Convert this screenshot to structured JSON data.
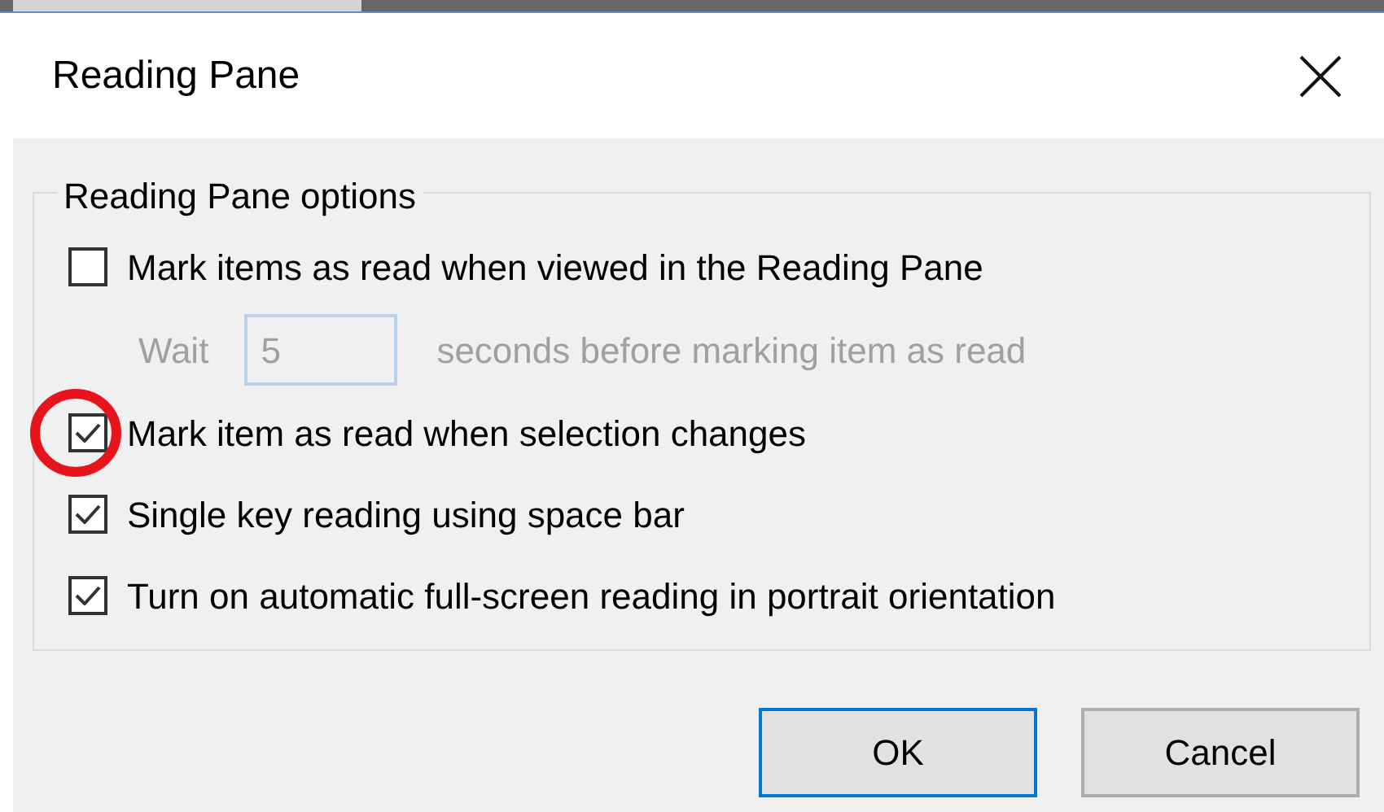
{
  "window": {
    "title": "Reading Pane"
  },
  "group": {
    "legend": "Reading Pane options"
  },
  "options": [
    {
      "kind": "checkbox",
      "label": "Mark items as read when viewed in the Reading Pane",
      "checked": false,
      "circled": false
    },
    {
      "kind": "wait",
      "before": "Wait",
      "value": "5",
      "after": "seconds before marking item as read",
      "disabled": true
    },
    {
      "kind": "checkbox",
      "label": "Mark item as read when selection changes",
      "checked": true,
      "circled": true
    },
    {
      "kind": "checkbox",
      "label": "Single key reading using space bar",
      "checked": true,
      "circled": false
    },
    {
      "kind": "checkbox",
      "label": "Turn on automatic full-screen reading in portrait orientation",
      "checked": true,
      "circled": false
    }
  ],
  "buttons": [
    {
      "label": "OK",
      "default": true
    },
    {
      "label": "Cancel",
      "default": false
    }
  ]
}
